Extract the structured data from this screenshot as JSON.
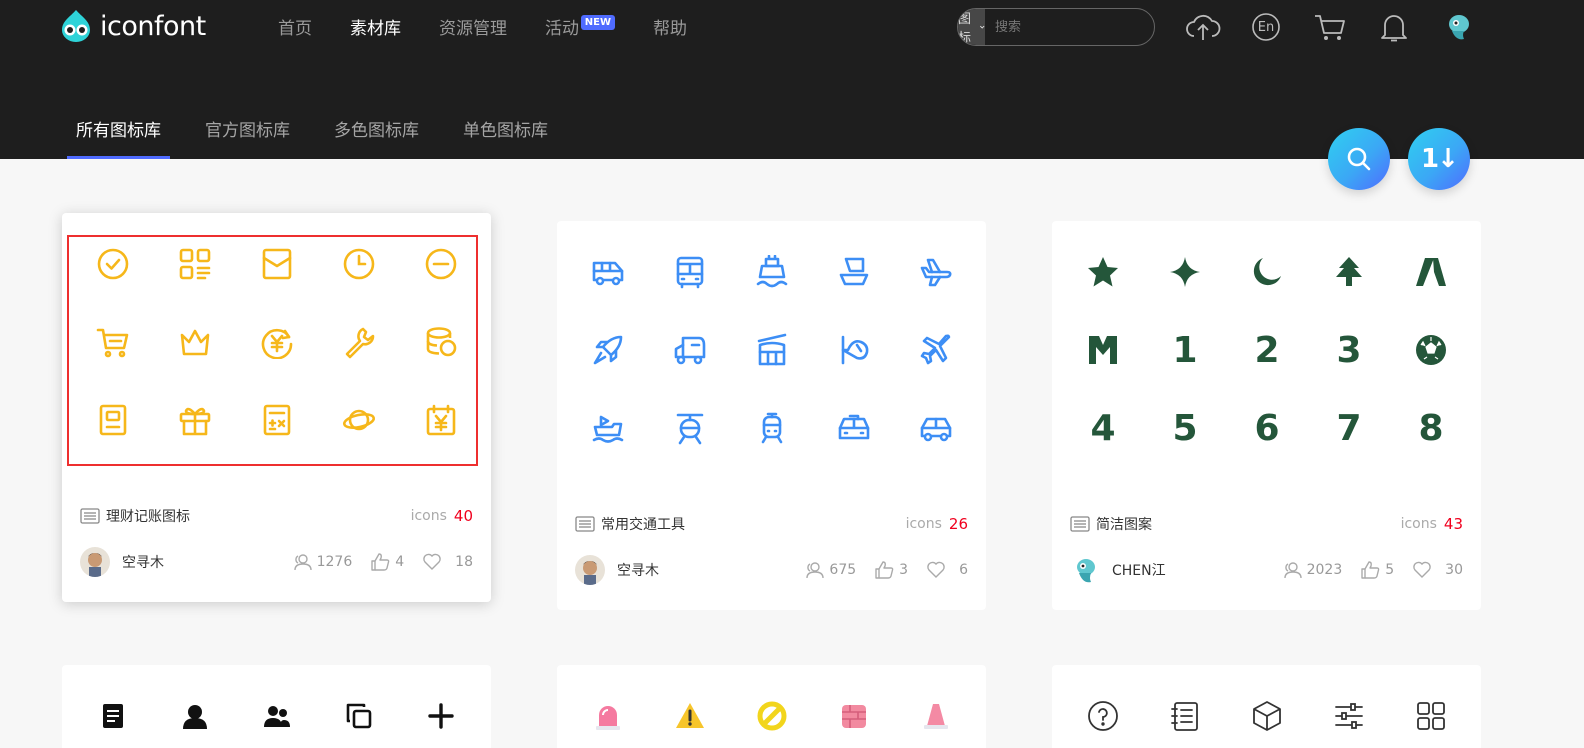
{
  "header": {
    "logo_text": "iconfont",
    "nav": [
      {
        "label": "首页"
      },
      {
        "label": "素材库"
      },
      {
        "label": "资源管理"
      },
      {
        "label": "活动",
        "badge": "NEW"
      },
      {
        "label": "帮助"
      }
    ],
    "search": {
      "type_label": "图标",
      "placeholder": "搜索"
    },
    "icons": [
      "upload-icon",
      "language-en-icon",
      "cart-icon",
      "bell-icon",
      "user-avatar"
    ],
    "lang_label": "En"
  },
  "tabs": [
    {
      "label": "所有图标库"
    },
    {
      "label": "官方图标库"
    },
    {
      "label": "多色图标库"
    },
    {
      "label": "单色图标库"
    }
  ],
  "fabs": {
    "sort_label": "1↓"
  },
  "colors": {
    "accent": "#4f6bff",
    "yellow": "#f6b71a",
    "blue": "#3d8ef5",
    "green": "#24563a",
    "count": "#f0001e"
  },
  "cards": [
    {
      "name": "理财记账图标",
      "icons_label": "icons",
      "count": "40",
      "author": "空寻木",
      "followers": "1276",
      "likes": "4",
      "favorites": "18"
    },
    {
      "name": "常用交通工具",
      "icons_label": "icons",
      "count": "26",
      "author": "空寻木",
      "followers": "675",
      "likes": "3",
      "favorites": "6"
    },
    {
      "name": "简洁图案",
      "icons_label": "icons",
      "count": "43",
      "author": "CHEN江",
      "followers": "2023",
      "likes": "5",
      "favorites": "30"
    }
  ],
  "green_glyphs": [
    "1",
    "2",
    "3",
    "4",
    "5",
    "6",
    "7",
    "8"
  ]
}
